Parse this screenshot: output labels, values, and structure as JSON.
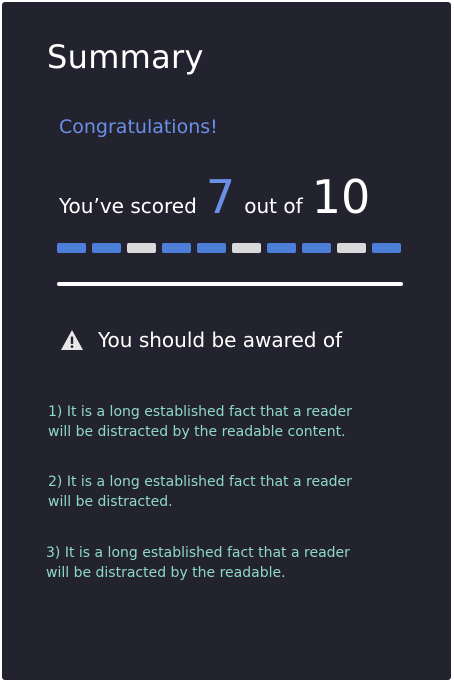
{
  "summary": {
    "title": "Summary",
    "congrats": "Congratulations!",
    "score_prefix": "You’ve scored",
    "score": "7",
    "score_middle": "out of",
    "total": "10",
    "results": [
      "correct",
      "correct",
      "wrong",
      "correct",
      "correct",
      "wrong",
      "correct",
      "correct",
      "wrong",
      "correct"
    ],
    "warning": {
      "icon": "warning-triangle-icon",
      "text": "You should be awared of"
    },
    "notes": [
      [
        "1) It is a long established fact that a reader",
        "will be distracted by the readable content."
      ],
      [
        "2) It is a long established fact that a reader",
        "will be distracted."
      ],
      [
        "3) It is a long established fact that a reader",
        "will be distracted by the readable."
      ]
    ]
  },
  "colors": {
    "background": "#23232f",
    "accent": "#6b8fe6",
    "correct": "#4d7fd8",
    "wrong": "#d9d9d9",
    "note_text": "#8fd8c6"
  }
}
